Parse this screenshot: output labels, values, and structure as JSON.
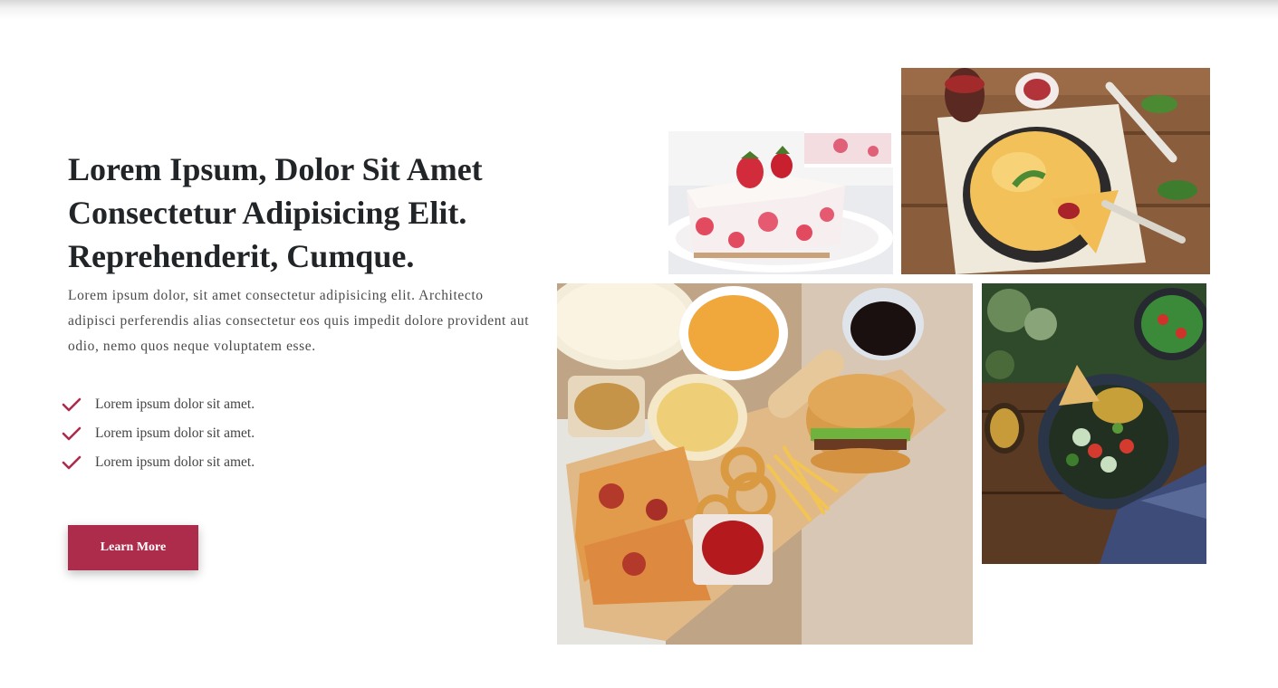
{
  "hero": {
    "headline": "Lorem Ipsum, Dolor Sit Amet Consectetur Adipisicing Elit. Reprehenderit, Cumque.",
    "description": "Lorem ipsum dolor, sit amet consectetur adipisicing elit. Architecto adipisci perferendis alias consectetur eos quis impedit dolore provident aut odio, nemo quos neque voluptatem esse.",
    "features": [
      {
        "icon": "check-icon",
        "text": "Lorem ipsum dolor sit amet."
      },
      {
        "icon": "check-icon",
        "text": "Lorem ipsum dolor sit amet."
      },
      {
        "icon": "check-icon",
        "text": "Lorem ipsum dolor sit amet."
      }
    ],
    "cta_label": "Learn More"
  },
  "gallery": {
    "images": [
      {
        "name": "strawberry-cake-photo"
      },
      {
        "name": "quiche-photo"
      },
      {
        "name": "fast-food-photo"
      },
      {
        "name": "salad-bowl-photo"
      }
    ]
  },
  "colors": {
    "accent": "#ad2c4c",
    "heading": "#222528",
    "body_text": "#4a4a4a"
  }
}
